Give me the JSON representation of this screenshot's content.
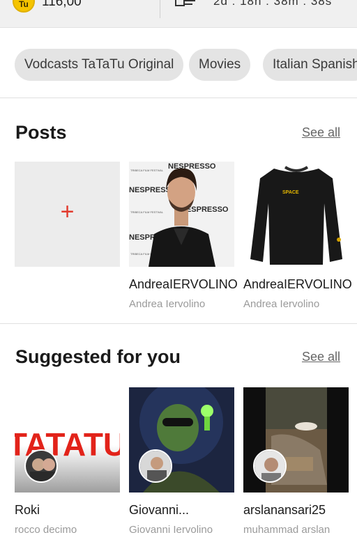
{
  "status": {
    "coin_label": "Tu",
    "balance": "116,00",
    "timer": "2d : 18h : 38m : 38s",
    "coin_color": "#f5c400"
  },
  "chips": [
    {
      "label": "Vodcasts TaTaTu Original"
    },
    {
      "label": "Movies"
    },
    {
      "label": "Italian Spanish"
    }
  ],
  "posts": {
    "title": "Posts",
    "see_all": "See all",
    "add_icon": "plus-icon",
    "items": [
      {
        "title": "AndreaIERVOLINO",
        "subtitle": "Andrea Iervolino"
      },
      {
        "title": "AndreaIERVOLINO",
        "subtitle": "Andrea Iervolino"
      }
    ],
    "poster_words": {
      "brand": "NESPRESSO",
      "festival": "TRIBECA FILM FESTIVAL",
      "shirt_logo": "SPACE"
    }
  },
  "suggested": {
    "title": "Suggested for you",
    "see_all": "See all",
    "items": [
      {
        "title": "Roki",
        "subtitle": "rocco decimo",
        "cover_text": "TATATU"
      },
      {
        "title": "Giovanni...",
        "subtitle": "Giovanni Iervolino"
      },
      {
        "title": "arslanansari25",
        "subtitle": "muhammad arslan"
      }
    ]
  },
  "colors": {
    "accent": "#e23b2e",
    "chip_bg": "#e4e4e4"
  }
}
